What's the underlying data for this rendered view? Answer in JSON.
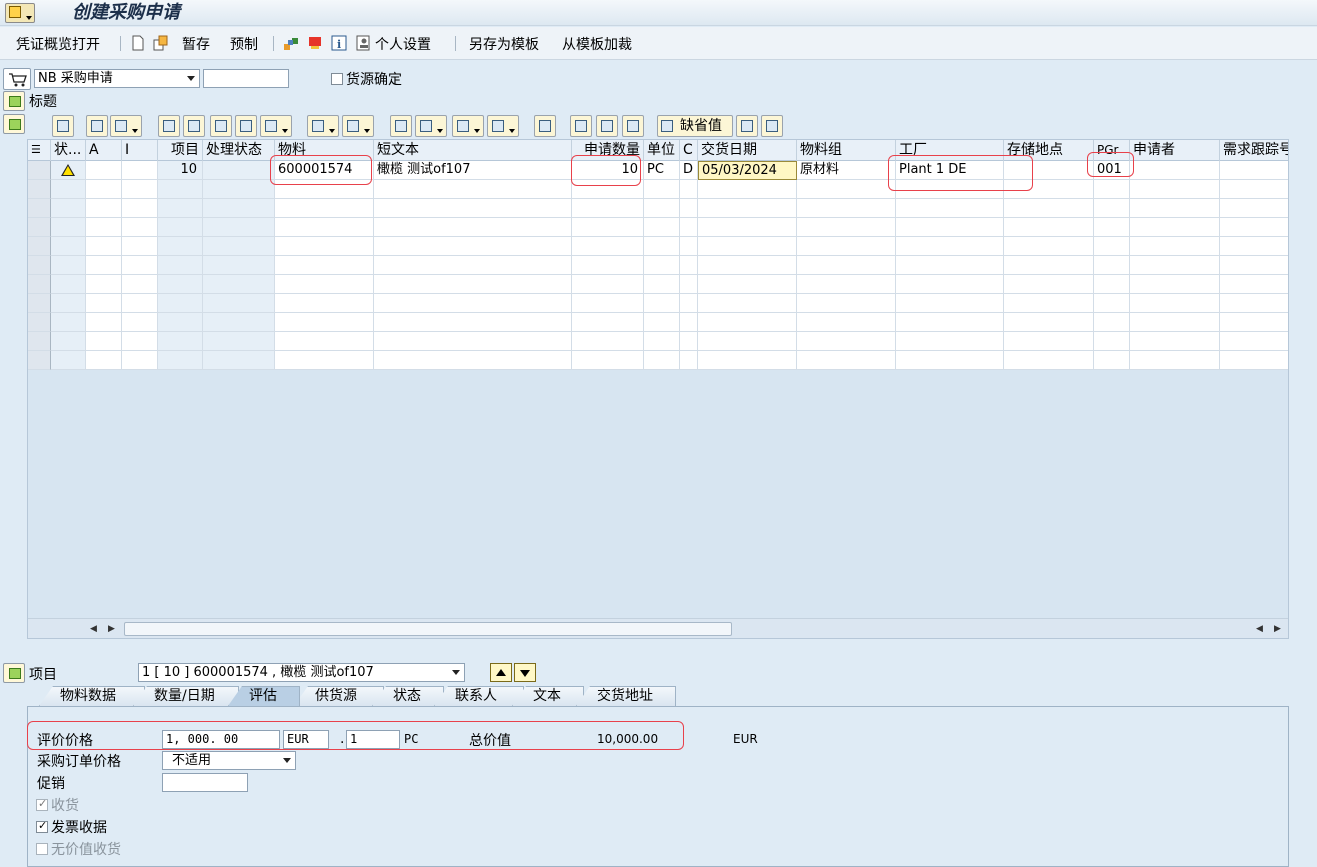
{
  "window": {
    "title": "创建采购申请"
  },
  "toolbar": {
    "overview_label": "凭证概览打开",
    "hold_label": "暂存",
    "park_label": "预制",
    "personal_settings_label": "个人设置",
    "save_as_template_label": "另存为模板",
    "load_template_label": "从模板加裁"
  },
  "header": {
    "doc_type": "NB 采购申请",
    "doc_number": "",
    "source_determination_label": "货源确定",
    "title_label": "标题"
  },
  "grid_toolbar": {
    "default_values_label": "缺省值"
  },
  "grid": {
    "columns": [
      "状...",
      "A",
      "I",
      "项目",
      "处理状态",
      "物料",
      "短文本",
      "申请数量",
      "单位",
      "C",
      "交货日期",
      "物料组",
      "工厂",
      "存储地点",
      "PGr",
      "申请者",
      "需求跟踪号"
    ],
    "row1": {
      "item": "10",
      "material": "600001574",
      "short_text": "橄榄 测试of107",
      "quantity": "10",
      "unit": "PC",
      "category": "D",
      "delivery_date": "05/03/2024",
      "material_group": "原材料",
      "plant": "Plant 1 DE",
      "pgr": "001"
    }
  },
  "item_section": {
    "label": "项目",
    "selector_value": "1 [ 10 ] 600001574 , 橄榄 测试of107"
  },
  "tabs": [
    "物料数据",
    "数量/日期",
    "评估",
    "供货源",
    "状态",
    "联系人",
    "文本",
    "交货地址"
  ],
  "valuation": {
    "price_label": "评价价格",
    "price_value": "1, 000. 00",
    "currency": "EUR",
    "per_value": "1",
    "per_unit": "PC",
    "total_label": "总价值",
    "total_value": "10,000.00",
    "total_currency": "EUR",
    "po_price_label": "采购订单价格",
    "po_price_value": "不适用",
    "promotion_label": "促销",
    "gr_label": "收货",
    "ir_label": "发票收据",
    "no_value_gr_label": "无价值收货"
  }
}
